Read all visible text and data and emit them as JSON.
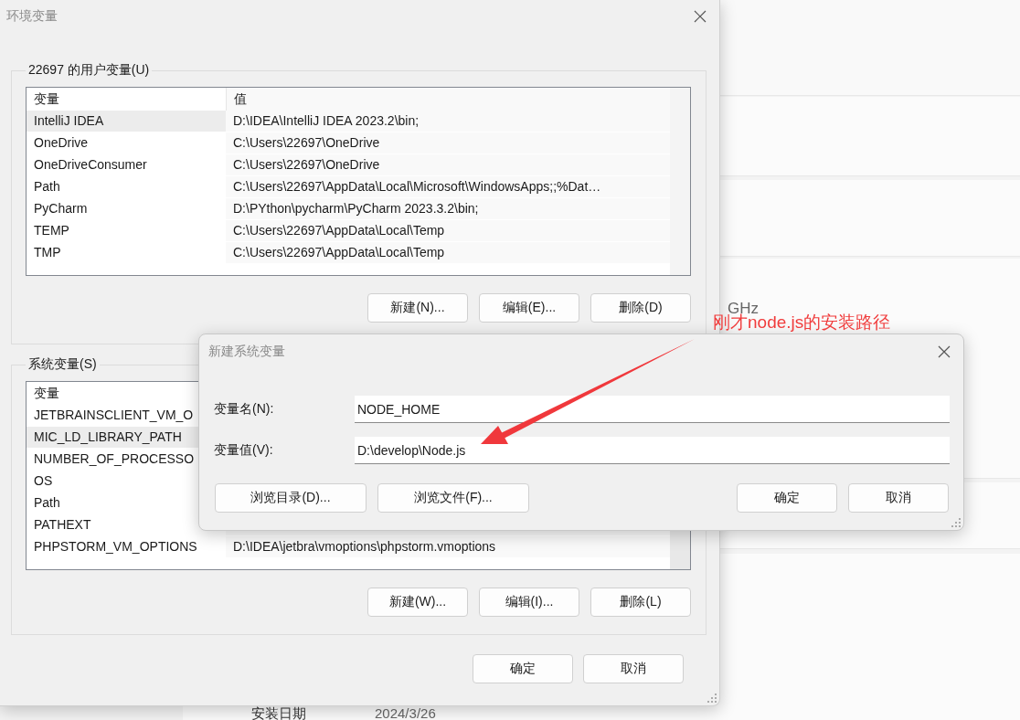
{
  "background_settings": {
    "partial_text": "GHz",
    "install_date_label": "安装日期",
    "install_date_value": "2024/3/26"
  },
  "environment_dialog": {
    "title": "环境变量",
    "user_variables": {
      "label": "22697 的用户变量(U)",
      "columns": [
        "变量",
        "值"
      ],
      "rows": [
        {
          "name": "IntelliJ IDEA",
          "value": "D:\\IDEA\\IntelliJ IDEA 2023.2\\bin;",
          "selected": true
        },
        {
          "name": "OneDrive",
          "value": "C:\\Users\\22697\\OneDrive",
          "selected": false
        },
        {
          "name": "OneDriveConsumer",
          "value": "C:\\Users\\22697\\OneDrive",
          "selected": false
        },
        {
          "name": "Path",
          "value": "C:\\Users\\22697\\AppData\\Local\\Microsoft\\WindowsApps;;%Dat…",
          "selected": false
        },
        {
          "name": "PyCharm",
          "value": "D:\\PYthon\\pycharm\\PyCharm 2023.3.2\\bin;",
          "selected": false
        },
        {
          "name": "TEMP",
          "value": "C:\\Users\\22697\\AppData\\Local\\Temp",
          "selected": false
        },
        {
          "name": "TMP",
          "value": "C:\\Users\\22697\\AppData\\Local\\Temp",
          "selected": false
        }
      ],
      "buttons": [
        "新建(N)...",
        "编辑(E)...",
        "删除(D)"
      ]
    },
    "system_variables": {
      "label": "系统变量(S)",
      "columns": [
        "变量"
      ],
      "rows": [
        {
          "name": "JETBRAINSCLIENT_VM_O",
          "selected": false
        },
        {
          "name": "MIC_LD_LIBRARY_PATH",
          "selected": true
        },
        {
          "name": "NUMBER_OF_PROCESSO",
          "selected": false
        },
        {
          "name": "OS",
          "selected": false
        },
        {
          "name": "Path",
          "selected": false
        },
        {
          "name": "PATHEXT",
          "selected": false
        },
        {
          "name": "PHPSTORM_VM_OPTIONS",
          "value": "D:\\IDEA\\jetbra\\vmoptions\\phpstorm.vmoptions",
          "selected": false
        }
      ],
      "buttons": [
        "新建(W)...",
        "编辑(I)...",
        "删除(L)"
      ]
    },
    "buttons": [
      "确定",
      "取消"
    ]
  },
  "new_variable_dialog": {
    "title": "新建系统变量",
    "fields": [
      {
        "label": "变量名(N):",
        "value": "NODE_HOME"
      },
      {
        "label": "变量值(V):",
        "value": "D:\\develop\\Node.js"
      }
    ],
    "left_buttons": [
      "浏览目录(D)...",
      "浏览文件(F)..."
    ],
    "right_buttons": [
      "确定",
      "取消"
    ]
  },
  "annotation": {
    "text": "刚才node.js的安装路径"
  }
}
